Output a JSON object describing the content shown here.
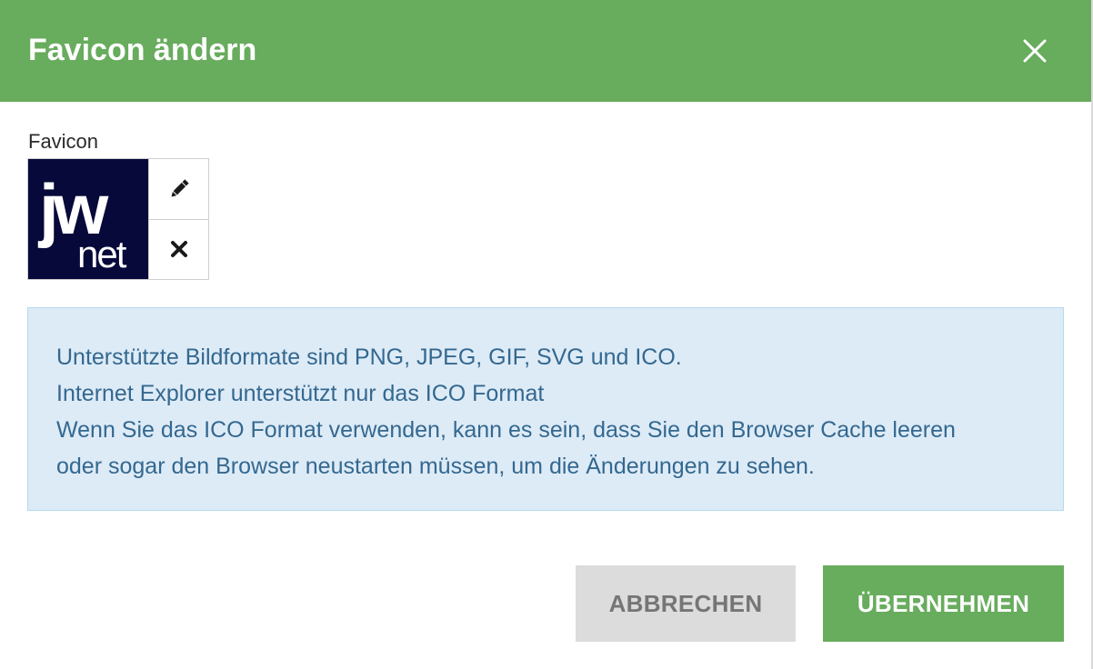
{
  "dialog": {
    "title": "Favicon ändern",
    "header_color": "#68ac5d"
  },
  "favicon": {
    "label": "Favicon",
    "logo_text_top": "jw",
    "logo_text_bottom": "net",
    "logo_bg": "#07093a",
    "edit_icon": "pencil-icon",
    "remove_icon": "x-mark-icon"
  },
  "info": {
    "lines": [
      "Unterstützte Bildformate sind PNG, JPEG, GIF, SVG und ICO.",
      "Internet Explorer unterstützt nur das ICO Format",
      "Wenn Sie das ICO Format verwenden, kann es sein, dass Sie den Browser Cache leeren",
      "oder sogar den Browser neustarten müssen, um die Änderungen zu sehen."
    ]
  },
  "buttons": {
    "cancel_label": "ABBRECHEN",
    "apply_label": "ÜBERNEHMEN"
  }
}
